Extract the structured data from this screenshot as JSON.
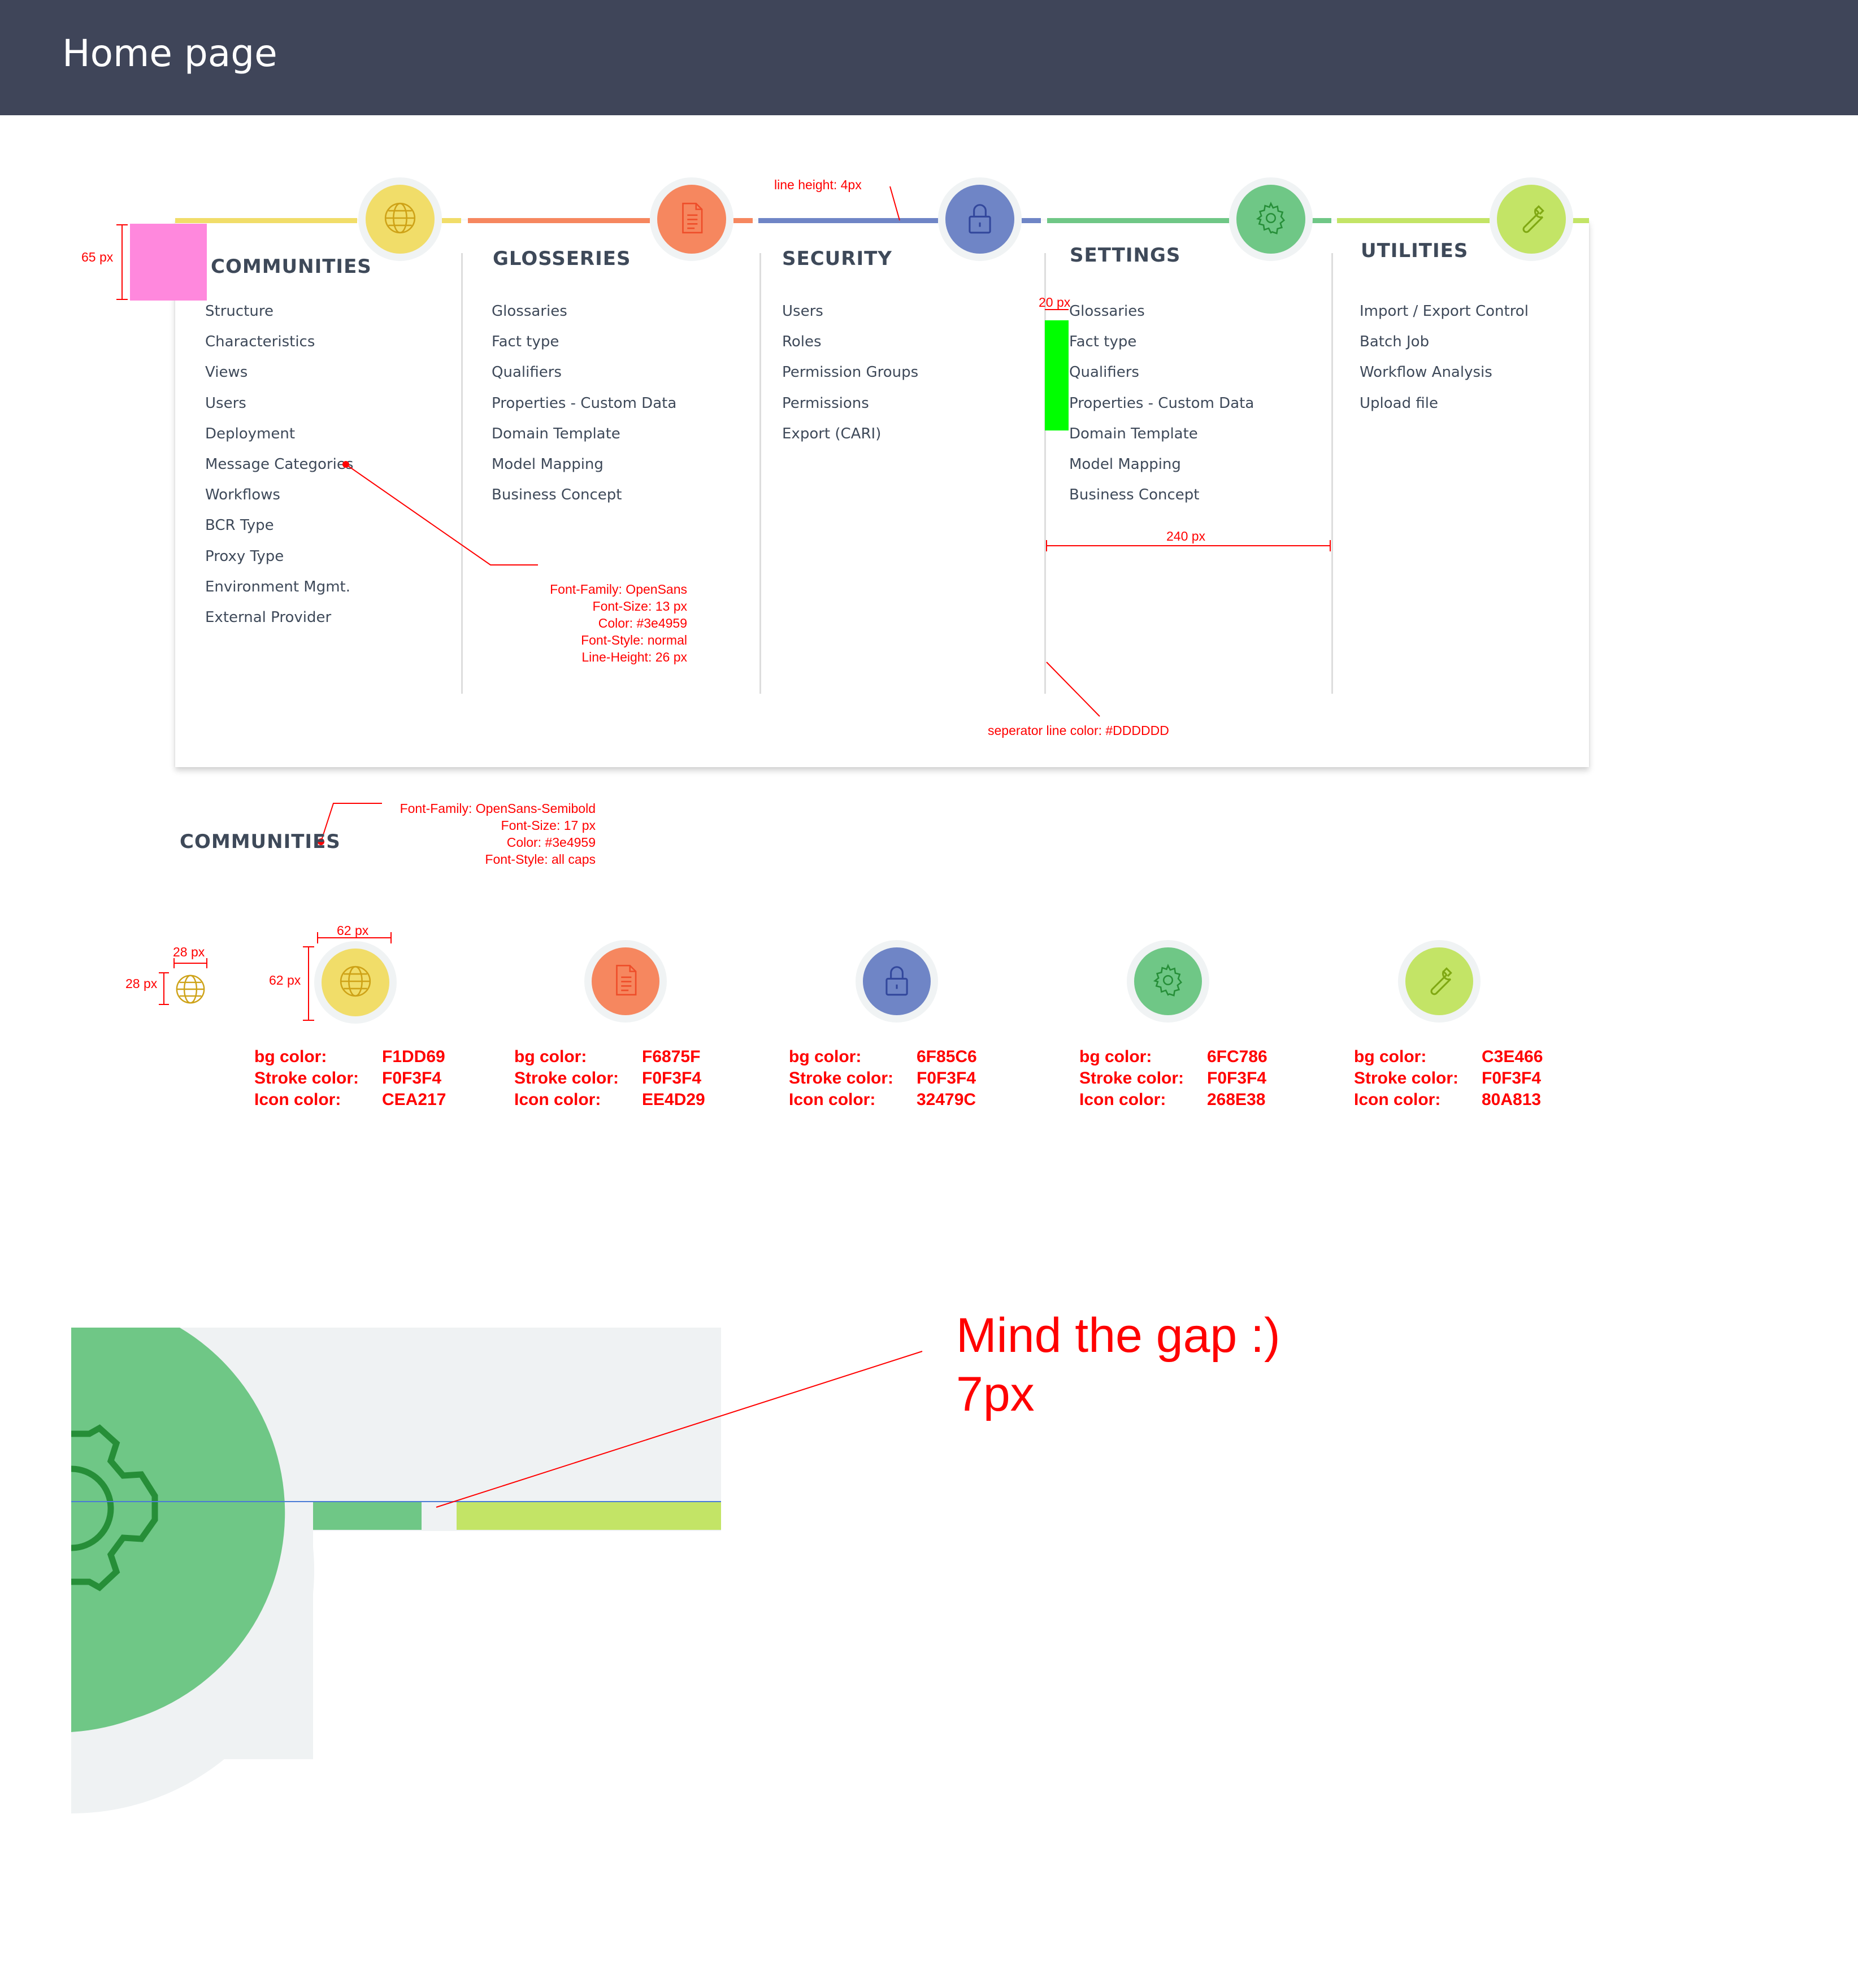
{
  "header": {
    "title": "Home page"
  },
  "colors": {
    "header_bg": "#3f4559",
    "text": "#3e4959",
    "separator": "#DDDDDD",
    "annotation": "#ff0000"
  },
  "columns": [
    {
      "key": "communities",
      "title": "COMMUNITIES",
      "icon": "globe-icon",
      "bg": "#F1DD69",
      "icon_color": "#CEA217",
      "items": [
        "Structure",
        "Characteristics",
        "Views",
        "Users",
        "Deployment",
        "Message Categories",
        "Workflows",
        "BCR Type",
        "Proxy Type",
        "Environment Mgmt.",
        "External Provider"
      ]
    },
    {
      "key": "glosseries",
      "title": "GLOSSERIES",
      "icon": "document-icon",
      "bg": "#F6875F",
      "icon_color": "#EE4D29",
      "items": [
        "Glossaries",
        "Fact type",
        "Qualifiers",
        "Properties - Custom Data",
        "Domain Template",
        "Model Mapping",
        "Business Concept"
      ]
    },
    {
      "key": "security",
      "title": "SECURITY",
      "icon": "lock-icon",
      "bg": "#6F85C6",
      "icon_color": "#32479C",
      "items": [
        "Users",
        "Roles",
        "Permission Groups",
        "Permissions",
        "Export (CARI)"
      ]
    },
    {
      "key": "settings",
      "title": "SETTINGS",
      "icon": "gear-icon",
      "bg": "#6FC786",
      "icon_color": "#268E38",
      "items": [
        "Glossaries",
        "Fact type",
        "Qualifiers",
        "Properties - Custom Data",
        "Domain Template",
        "Model Mapping",
        "Business Concept"
      ]
    },
    {
      "key": "utilities",
      "title": "UTILITIES",
      "icon": "wrench-icon",
      "bg": "#C3E466",
      "icon_color": "#80A813",
      "items": [
        "Import / Export Control",
        "Batch Job",
        "Workflow Analysis",
        "Upload file"
      ]
    }
  ],
  "annotations": {
    "line_height": "line height: 4px",
    "height_65": "65 px",
    "gap_20": "20 px",
    "width_240": "240 px",
    "separator_color": "seperator line color: #DDDDDD",
    "menu_font": [
      "Font-Family: OpenSans",
      "Font-Size: 13 px",
      "Color: #3e4959",
      "Font-Style: normal",
      "Line-Height: 26 px"
    ],
    "title_sample": "COMMUNITIES",
    "title_font": [
      "Font-Family: OpenSans-Semibold",
      "Font-Size: 17 px",
      "Color: #3e4959",
      "Font-Style: all caps"
    ],
    "size_28_w": "28 px",
    "size_28_h": "28 px",
    "size_62_w": "62 px",
    "size_62_h": "62 px",
    "mind_gap_line1": "Mind the gap :)",
    "mind_gap_line2": "7px"
  },
  "spec_labels": {
    "bg": "bg  color:",
    "stroke": "Stroke color:",
    "icon": "Icon color:"
  },
  "specs": [
    {
      "bg": "F1DD69",
      "stroke": "F0F3F4",
      "icon": "CEA217"
    },
    {
      "bg": "F6875F",
      "stroke": "F0F3F4",
      "icon": "EE4D29"
    },
    {
      "bg": "6F85C6",
      "stroke": "F0F3F4",
      "icon": "32479C"
    },
    {
      "bg": "6FC786",
      "stroke": "F0F3F4",
      "icon": "268E38"
    },
    {
      "bg": "C3E466",
      "stroke": "F0F3F4",
      "icon": "80A813"
    }
  ]
}
